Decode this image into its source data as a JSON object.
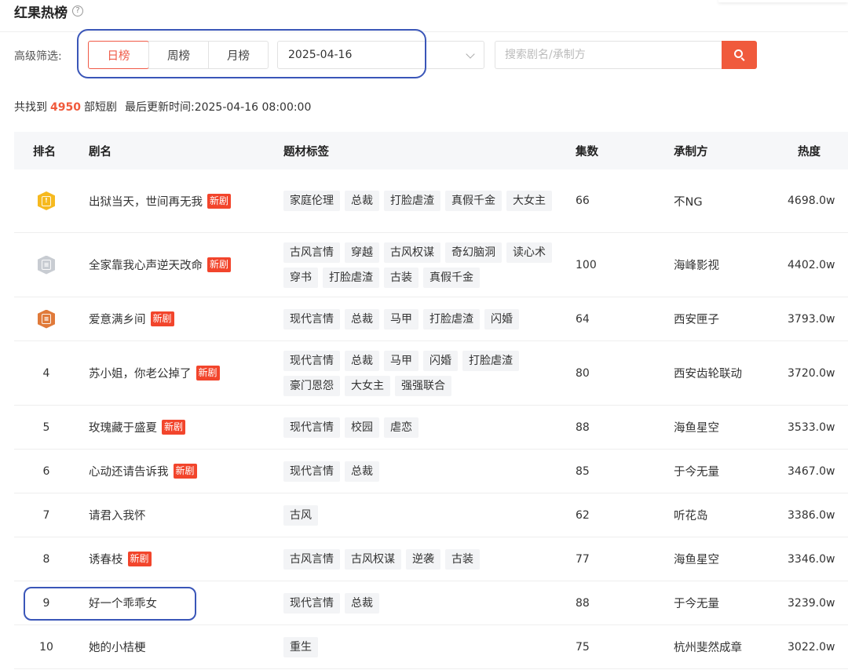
{
  "header": {
    "title": "红果热榜",
    "help_icon": "?"
  },
  "filters": {
    "label": "高级筛选:",
    "tabs": [
      {
        "label": "日榜",
        "active": true
      },
      {
        "label": "周榜",
        "active": false
      },
      {
        "label": "月榜",
        "active": false
      }
    ],
    "date_value": "2025-04-16",
    "search_placeholder": "搜索剧名/承制方"
  },
  "summary": {
    "prefix": "共找到",
    "count": "4950",
    "suffix": "部短剧",
    "updated_label": "最后更新时间:",
    "updated_time": "2025-04-16 08:00:00"
  },
  "table": {
    "columns": [
      "排名",
      "剧名",
      "题材标签",
      "集数",
      "承制方",
      "热度"
    ],
    "new_badge": "新剧",
    "rows": [
      {
        "rank": "1",
        "medal": "gold",
        "name": "出狱当天，世间再无我",
        "is_new": true,
        "tags": [
          "家庭伦理",
          "总裁",
          "打脸虐渣",
          "真假千金",
          "大女主"
        ],
        "episodes": "66",
        "producer": "不NG",
        "heat": "4698.0w"
      },
      {
        "rank": "2",
        "medal": "silver",
        "name": "全家靠我心声逆天改命",
        "is_new": true,
        "tags": [
          "古风言情",
          "穿越",
          "古风权谋",
          "奇幻脑洞",
          "读心术",
          "穿书",
          "打脸虐渣",
          "古装",
          "真假千金"
        ],
        "episodes": "100",
        "producer": "海峰影视",
        "heat": "4402.0w"
      },
      {
        "rank": "3",
        "medal": "bronze",
        "name": "爱意满乡间",
        "is_new": true,
        "tags": [
          "现代言情",
          "总裁",
          "马甲",
          "打脸虐渣",
          "闪婚"
        ],
        "episodes": "64",
        "producer": "西安匣子",
        "heat": "3793.0w"
      },
      {
        "rank": "4",
        "medal": "",
        "name": "苏小姐，你老公掉了",
        "is_new": true,
        "tags": [
          "现代言情",
          "总裁",
          "马甲",
          "闪婚",
          "打脸虐渣",
          "豪门恩怨",
          "大女主",
          "强强联合"
        ],
        "episodes": "80",
        "producer": "西安齿轮联动",
        "heat": "3720.0w"
      },
      {
        "rank": "5",
        "medal": "",
        "name": "玫瑰藏于盛夏",
        "is_new": true,
        "tags": [
          "现代言情",
          "校园",
          "虐恋"
        ],
        "episodes": "88",
        "producer": "海鱼星空",
        "heat": "3533.0w"
      },
      {
        "rank": "6",
        "medal": "",
        "name": "心动还请告诉我",
        "is_new": true,
        "tags": [
          "现代言情",
          "总裁"
        ],
        "episodes": "85",
        "producer": "于今无量",
        "heat": "3467.0w"
      },
      {
        "rank": "7",
        "medal": "",
        "name": "请君入我怀",
        "is_new": false,
        "tags": [
          "古风"
        ],
        "episodes": "62",
        "producer": "听花岛",
        "heat": "3386.0w"
      },
      {
        "rank": "8",
        "medal": "",
        "name": "诱春枝",
        "is_new": true,
        "tags": [
          "古风言情",
          "古风权谋",
          "逆袭",
          "古装"
        ],
        "episodes": "77",
        "producer": "海鱼星空",
        "heat": "3346.0w"
      },
      {
        "rank": "9",
        "medal": "",
        "name": "好一个乖乖女",
        "is_new": false,
        "tags": [
          "现代言情",
          "总裁"
        ],
        "episodes": "88",
        "producer": "于今无量",
        "heat": "3239.0w"
      },
      {
        "rank": "10",
        "medal": "",
        "name": "她的小桔梗",
        "is_new": false,
        "tags": [
          "重生"
        ],
        "episodes": "75",
        "producer": "杭州斐然成章",
        "heat": "3022.0w"
      }
    ]
  },
  "colors": {
    "accent": "#f05a3c",
    "badge": "#f2452c",
    "annotation": "#3a56b8"
  }
}
